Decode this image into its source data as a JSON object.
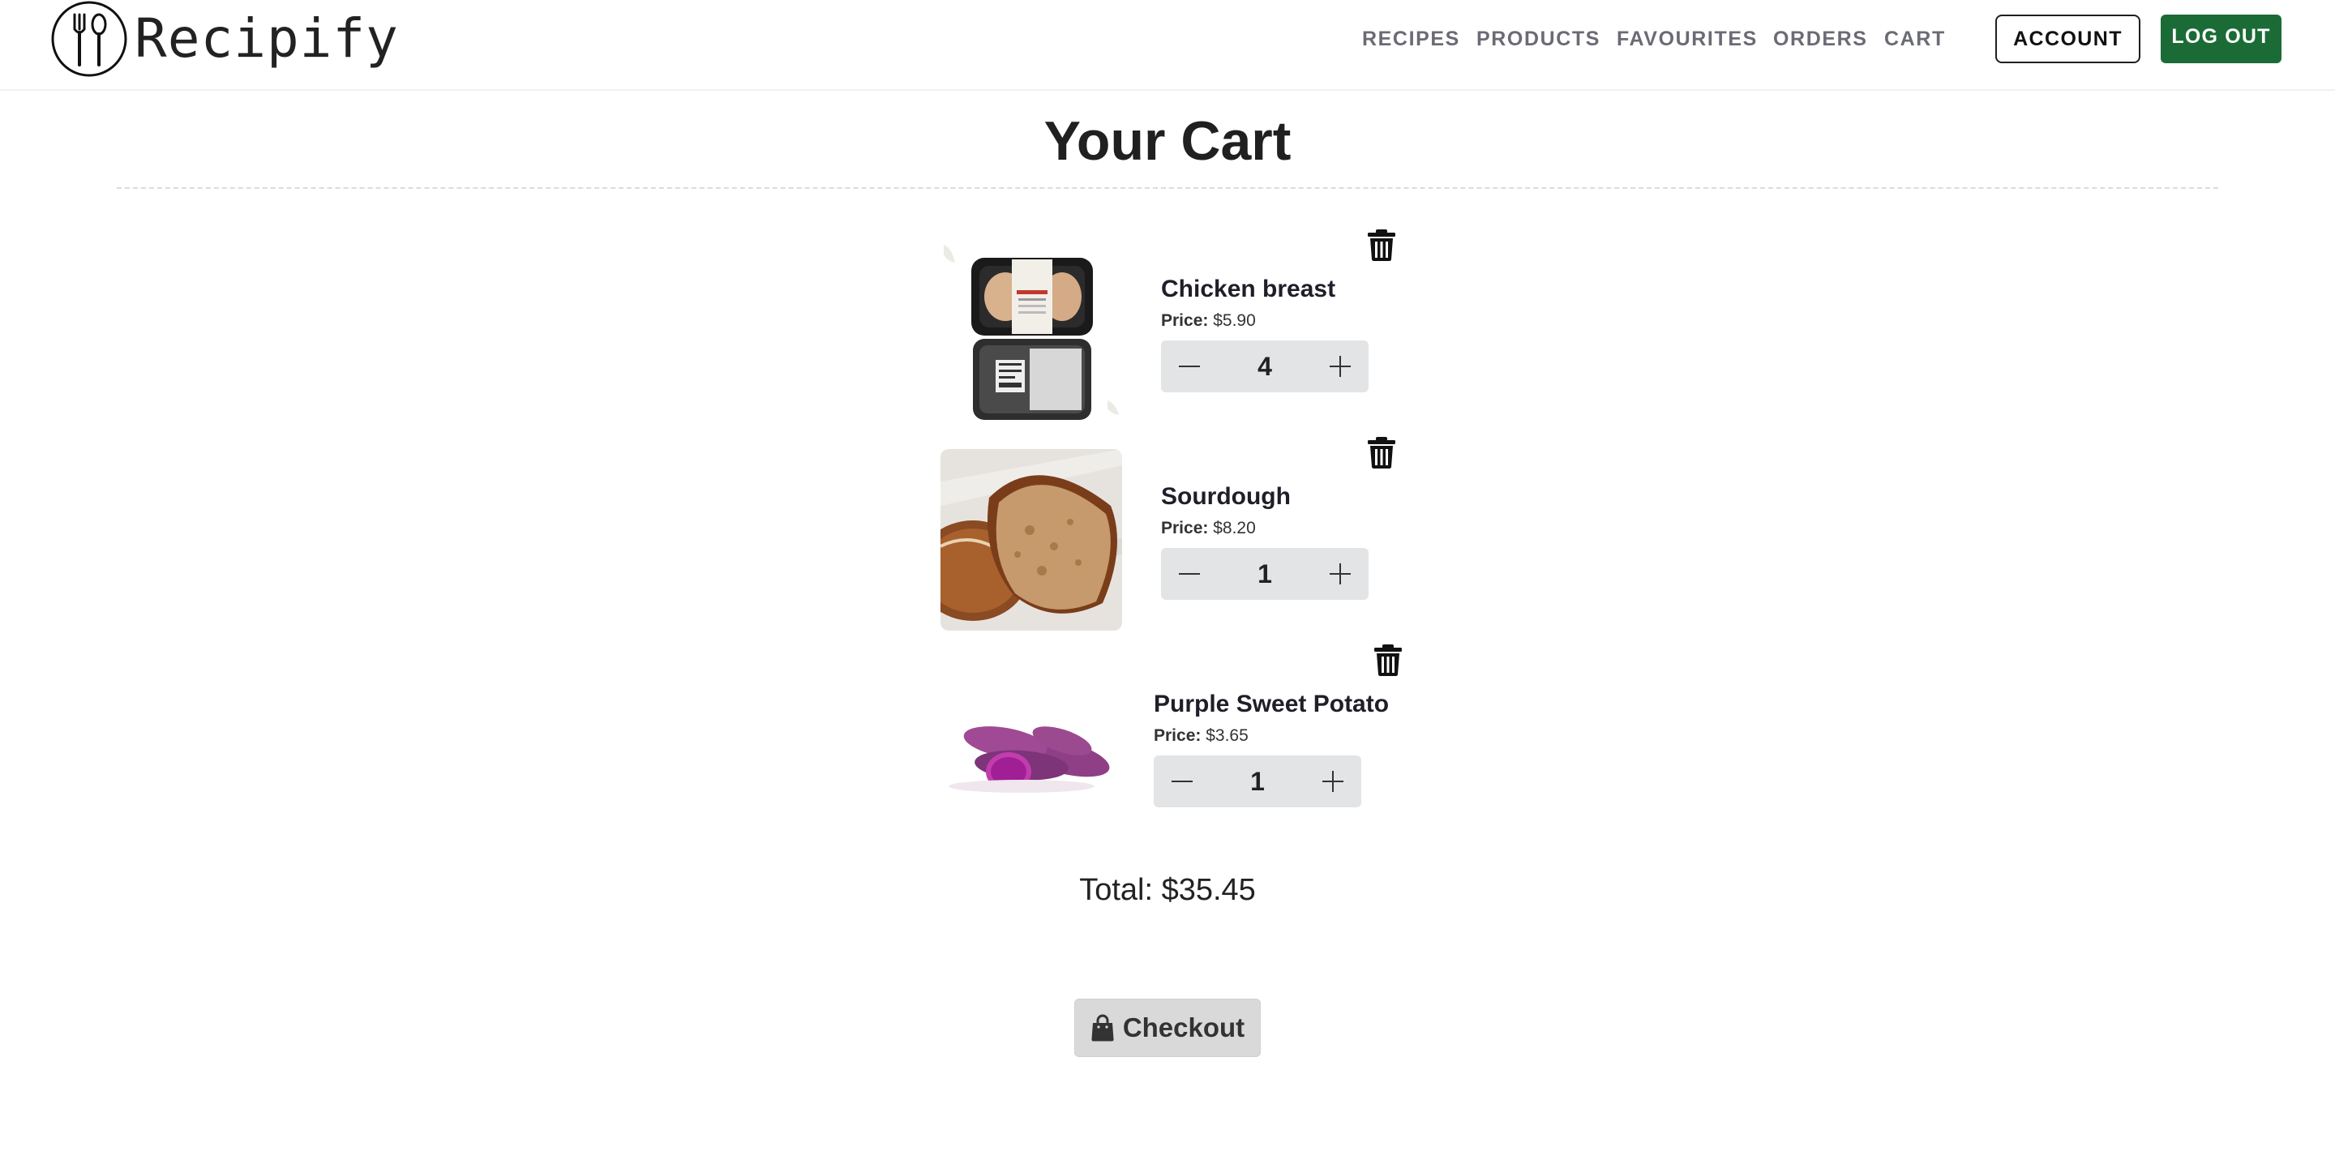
{
  "brand": {
    "name": "Recipify",
    "logo_icon": "fork-spoon-circle-icon"
  },
  "nav": {
    "items": [
      {
        "label": "RECIPES"
      },
      {
        "label": "PRODUCTS"
      },
      {
        "label": "FAVOURITES"
      },
      {
        "label": "ORDERS"
      },
      {
        "label": "CART"
      }
    ],
    "account_label": "ACCOUNT",
    "logout_label": "LOG OUT"
  },
  "page": {
    "title": "Your Cart"
  },
  "cart": {
    "price_label": "Price:",
    "items": [
      {
        "name": "Chicken breast",
        "price": "$5.90",
        "quantity": "4",
        "image": "packaged-chicken-breast-photo"
      },
      {
        "name": "Sourdough",
        "price": "$8.20",
        "quantity": "1",
        "image": "sourdough-loaf-photo"
      },
      {
        "name": "Purple Sweet Potato",
        "price": "$3.65",
        "quantity": "1",
        "image": "purple-sweet-potato-photo"
      }
    ],
    "total_text": "Total: $35.45",
    "checkout_label": "Checkout"
  },
  "colors": {
    "primary_green": "#1b6b36",
    "nav_text": "#6b6b76",
    "stepper_bg": "#e3e4e6",
    "checkout_bg": "#d9d9d9"
  }
}
